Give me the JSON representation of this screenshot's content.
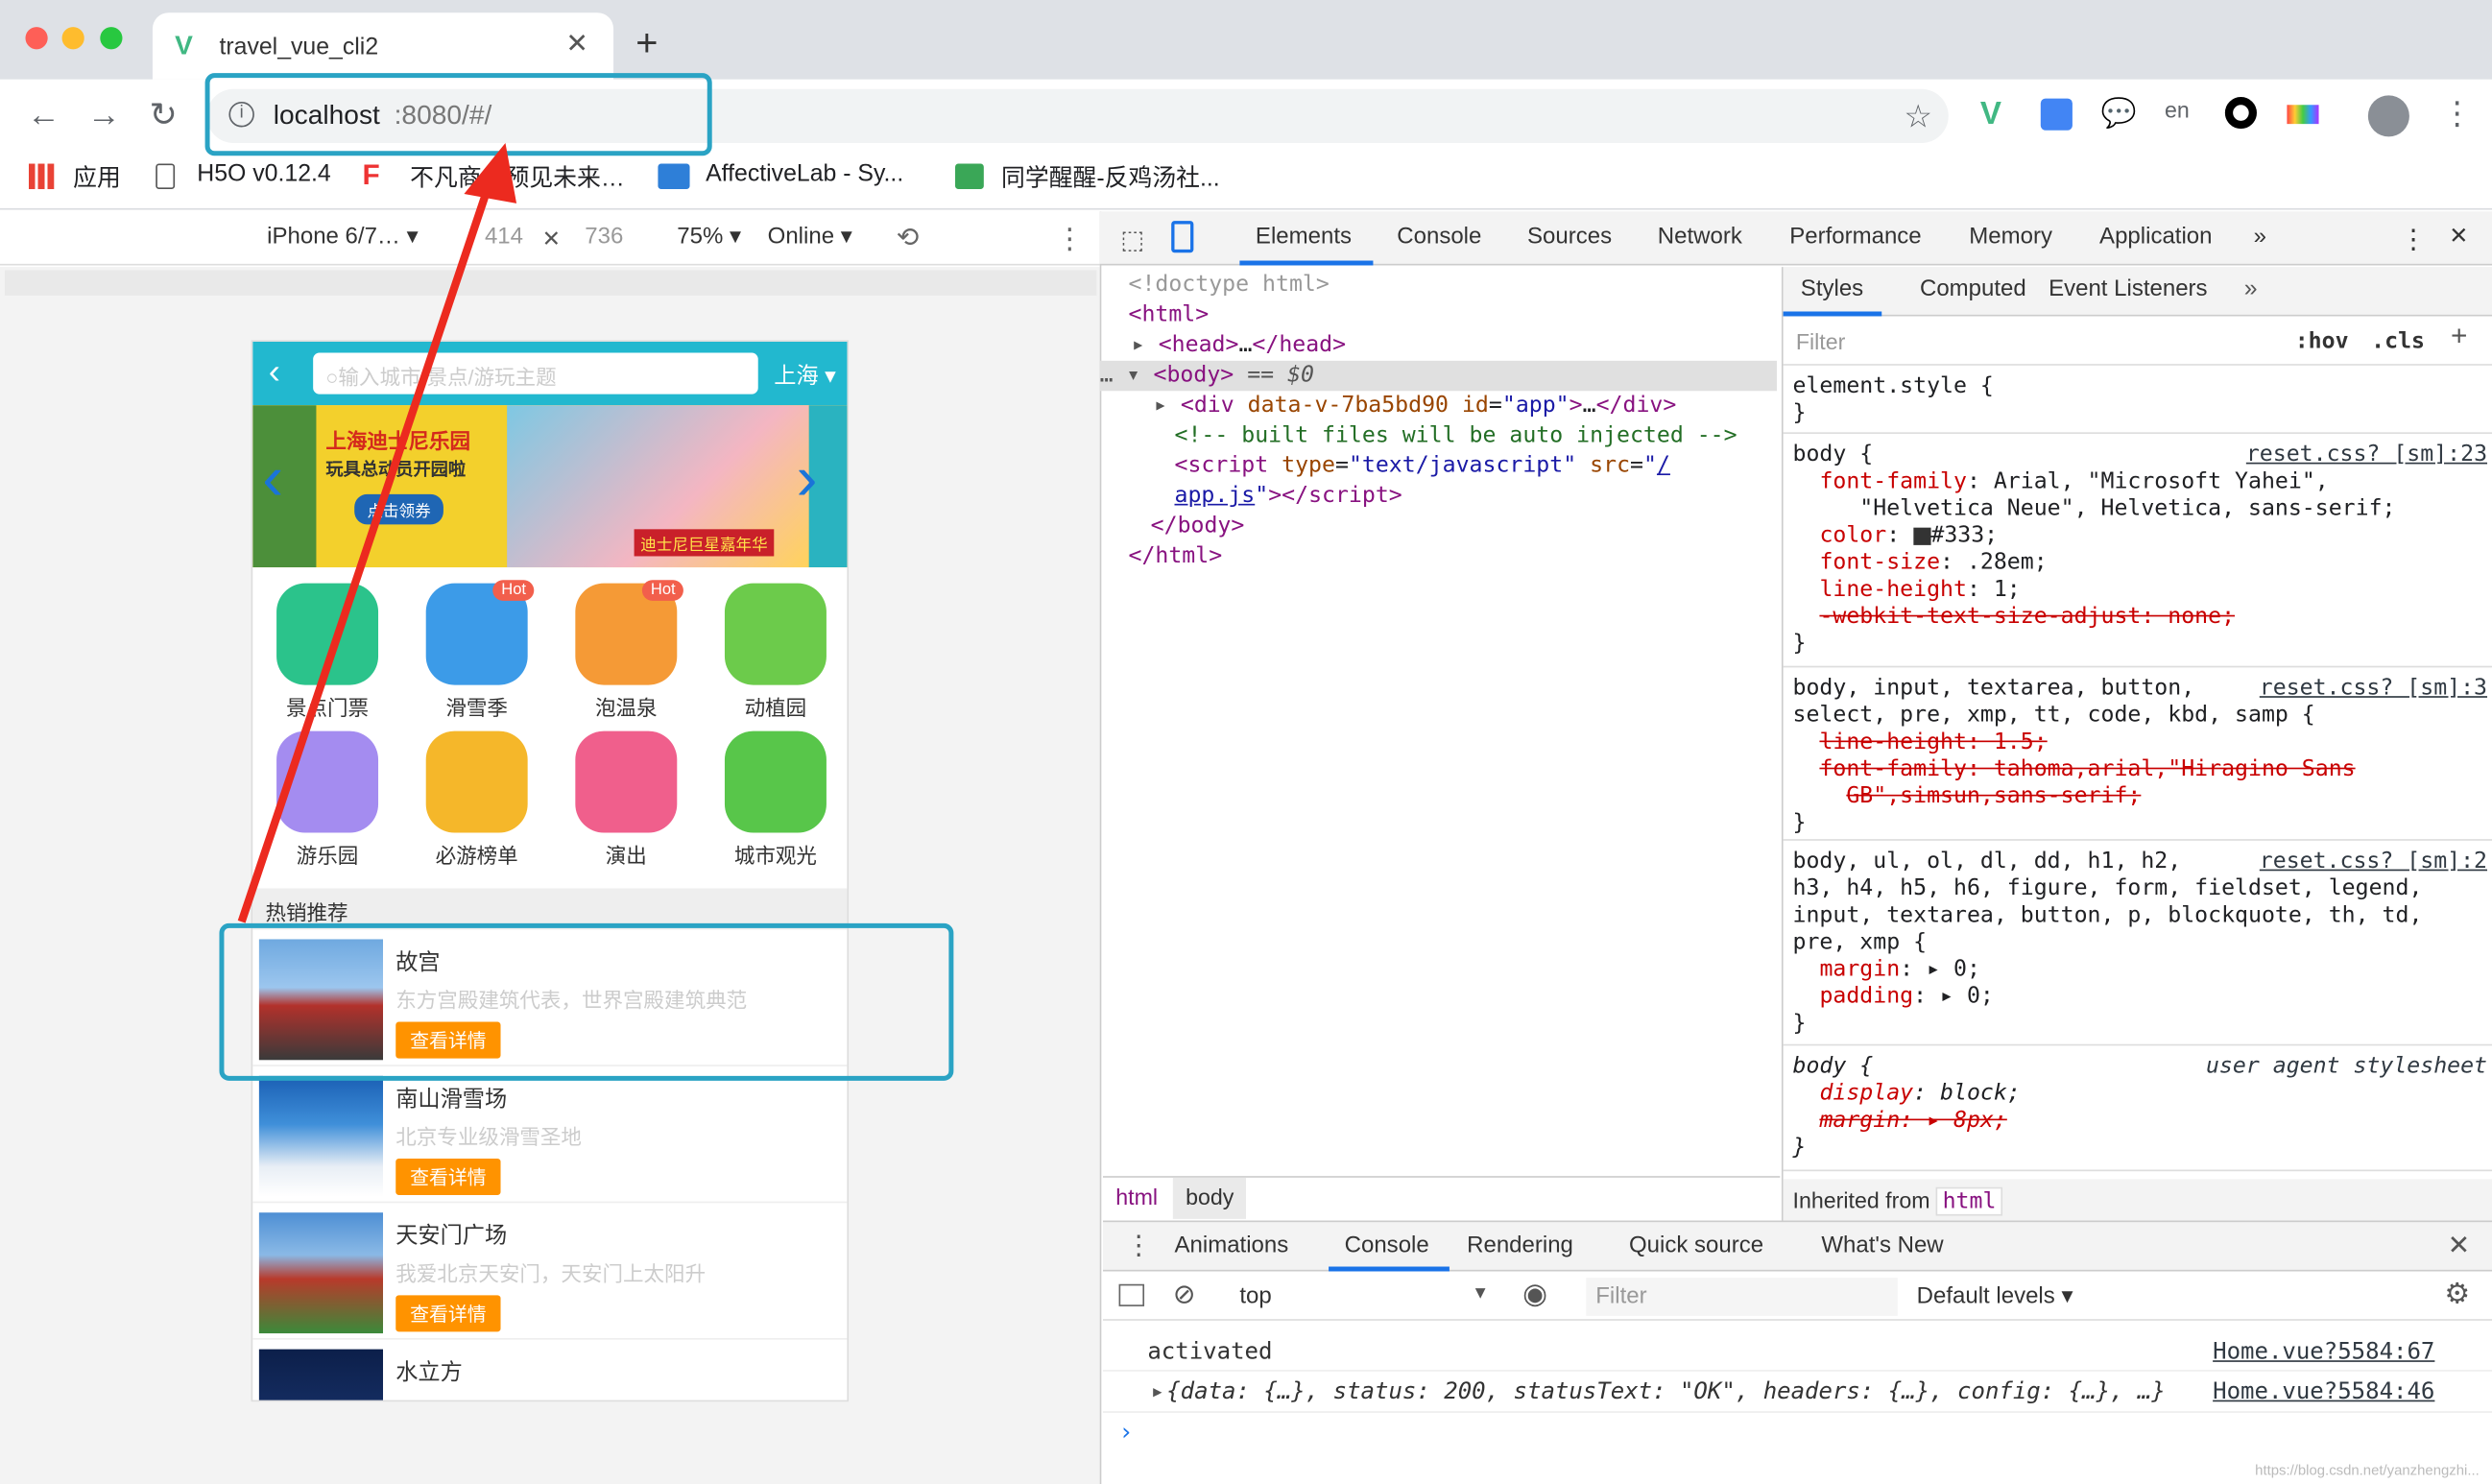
{
  "browser": {
    "tab_title": "travel_vue_cli2",
    "url_host": "localhost",
    "url_rest": ":8080/#/",
    "bookmarks": [
      "应用",
      "H5O v0.12.4",
      "不凡商…预见未来…",
      "AffectiveLab - Sy...",
      "同学醒醒-反鸡汤社..."
    ]
  },
  "device_toolbar": {
    "device": "iPhone 6/7…",
    "width": "414",
    "height": "736",
    "zoom": "75%",
    "throttle": "Online"
  },
  "app": {
    "city": "上海",
    "search_placeholder": "输入城市/景点/游玩主题",
    "banner_text1": "上海迪士尼乐园",
    "banner_text2": "玩具总动员开园啦",
    "banner_text3": "迪士尼巨星嘉年华",
    "banner_btn": "点击领券",
    "icons": [
      {
        "label": "景点门票",
        "color": "#2bc38b",
        "hot": ""
      },
      {
        "label": "滑雪季",
        "color": "#3c9be8",
        "hot": "Hot"
      },
      {
        "label": "泡温泉",
        "color": "#f59a36",
        "hot": "Hot"
      },
      {
        "label": "动植园",
        "color": "#6ccb4b",
        "hot": ""
      },
      {
        "label": "游乐园",
        "color": "#a48cf0",
        "hot": ""
      },
      {
        "label": "必游榜单",
        "color": "#f5b72a",
        "hot": ""
      },
      {
        "label": "演出",
        "color": "#f05f8c",
        "hot": ""
      },
      {
        "label": "城市观光",
        "color": "#58c64a",
        "hot": ""
      }
    ],
    "section_title": "热销推荐",
    "recommend": [
      {
        "title": "故宫",
        "desc": "东方宫殿建筑代表，世界宫殿建筑典范",
        "btn": "查看详情"
      },
      {
        "title": "南山滑雪场",
        "desc": "北京专业级滑雪圣地",
        "btn": "查看详情"
      },
      {
        "title": "天安门广场",
        "desc": "我爱北京天安门，天安门上太阳升",
        "btn": "查看详情"
      },
      {
        "title": "水立方",
        "desc": "",
        "btn": ""
      }
    ]
  },
  "devtools": {
    "tabs": [
      "Elements",
      "Console",
      "Sources",
      "Network",
      "Performance",
      "Memory",
      "Application"
    ],
    "styles_tabs": [
      "Styles",
      "Computed",
      "Event Listeners"
    ],
    "filter_placeholder": "Filter",
    "hov": ":hov",
    "cls": ".cls",
    "breadcrumbs": [
      "html",
      "body"
    ],
    "inherited_label": "Inherited from",
    "inherited_tag": "html",
    "drawer_tabs": [
      "Animations",
      "Console",
      "Rendering",
      "Quick source",
      "What's New"
    ],
    "context": "top",
    "console_filter": "Filter",
    "levels": "Default levels",
    "console_lines": [
      {
        "text": "activated",
        "src": "Home.vue?5584:67"
      },
      {
        "text": "{data: {…}, status: 200, statusText: \"OK\", headers: {…}, config: {…}, …}",
        "src": "Home.vue?5584:46"
      }
    ],
    "style_sources": [
      "reset.css? [sm]:23",
      "reset.css? [sm]:3",
      "reset.css? [sm]:2",
      "user agent stylesheet"
    ]
  },
  "watermark": "https://blog.csdn.net/yanzhengzhi..."
}
